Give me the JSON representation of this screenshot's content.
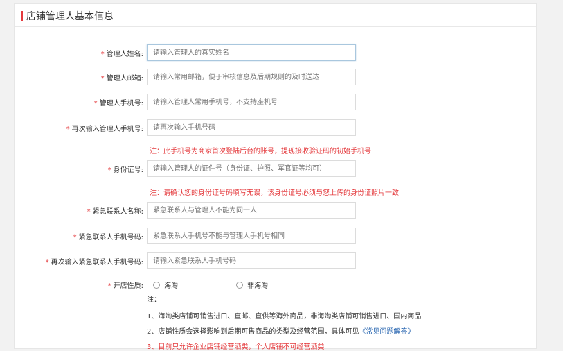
{
  "section_title": "店铺管理人基本信息",
  "required_mark": "*",
  "fields": [
    {
      "label": "管理人姓名:",
      "placeholder": "请输入管理人的真实姓名"
    },
    {
      "label": "管理人邮箱:",
      "placeholder": "请输入常用邮箱，便于审核信息及后期规则的及时送达"
    },
    {
      "label": "管理人手机号:",
      "placeholder": "请输入管理人常用手机号，不支持座机号"
    },
    {
      "label": "再次输入管理人手机号:",
      "placeholder": "请再次输入手机号码"
    },
    {
      "label": "身份证号:",
      "placeholder": "请输入管理人的证件号（身份证、护照、军官证等均可）"
    },
    {
      "label": "紧急联系人名称:",
      "placeholder": "紧急联系人与管理人不能为同一人"
    },
    {
      "label": "紧急联系人手机号码:",
      "placeholder": "紧急联系人手机号不能与管理人手机号相同"
    },
    {
      "label": "再次输入紧急联系人手机号码:",
      "placeholder": "请输入紧急联系人手机号码"
    }
  ],
  "warnings": {
    "phone": "注：此手机号为商家首次登陆后台的账号，提现接收验证码的初始手机号",
    "id": "注：请确认您的身份证号码填写无误，该身份证号必须与您上传的身份证照片一致"
  },
  "store_type": {
    "label": "开店性质:",
    "options": [
      "海淘",
      "非海淘"
    ]
  },
  "notes": {
    "heading": "注：",
    "line1": "1、海淘类店铺可销售进口、直邮、直供等海外商品，非海淘类店铺可销售进口、国内商品",
    "line2_prefix": "2、店铺性质会选择影响到后期可售商品的类型及经营范围，具体可见",
    "line2_link": "《常见问题解答》",
    "line3": "3、目前只允许企业店铺经营酒类，个人店铺不可经营酒类"
  },
  "colors": {
    "accent_red": "#e4393c",
    "link_blue": "#2a67b1"
  }
}
